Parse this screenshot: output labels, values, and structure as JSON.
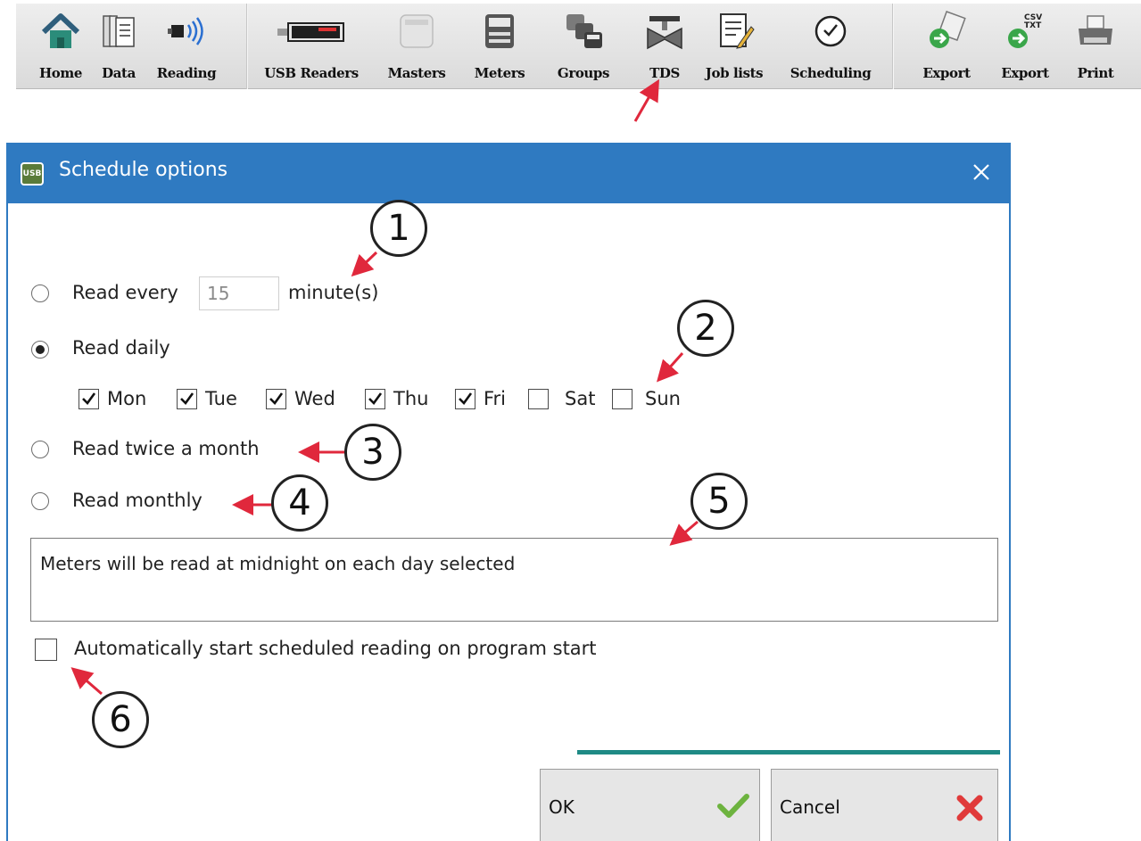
{
  "toolbar": {
    "items": [
      {
        "label": "Home",
        "icon": "home-icon"
      },
      {
        "label": "Data",
        "icon": "documents-icon"
      },
      {
        "label": "Reading",
        "icon": "signal-reader-icon"
      },
      {
        "label": "USB Readers",
        "icon": "usb-reader-icon"
      },
      {
        "label": "Masters",
        "icon": "master-meter-icon"
      },
      {
        "label": "Meters",
        "icon": "meter-icon"
      },
      {
        "label": "Groups",
        "icon": "meter-group-icon"
      },
      {
        "label": "TDS",
        "icon": "tds-valve-icon"
      },
      {
        "label": "Job lists",
        "icon": "job-list-icon"
      },
      {
        "label": "Scheduling",
        "icon": "clock-icon"
      },
      {
        "label": "Export",
        "icon": "export-icon"
      },
      {
        "label": "Export",
        "icon": "export-csv-txt-icon",
        "badge": "CSV\nTXT"
      },
      {
        "label": "Print",
        "icon": "printer-icon"
      }
    ]
  },
  "dialog": {
    "title": "Schedule options",
    "app_icon_text": "USB",
    "read_every": {
      "label": "Read every",
      "value": "15",
      "unit": "minute(s)",
      "checked": false
    },
    "read_daily": {
      "label": "Read daily",
      "checked": true
    },
    "days": [
      {
        "label": "Mon",
        "checked": true
      },
      {
        "label": "Tue",
        "checked": true
      },
      {
        "label": "Wed",
        "checked": true
      },
      {
        "label": "Thu",
        "checked": true
      },
      {
        "label": "Fri",
        "checked": true
      },
      {
        "label": "Sat",
        "checked": false
      },
      {
        "label": "Sun",
        "checked": false
      }
    ],
    "read_twice": {
      "label": "Read twice a month",
      "checked": false
    },
    "read_monthly": {
      "label": "Read monthly",
      "checked": false
    },
    "info_text": "Meters will be read at midnight on each day selected",
    "autostart": {
      "label": "Automatically start scheduled reading on program start",
      "checked": false
    },
    "ok_label": "OK",
    "cancel_label": "Cancel"
  },
  "callouts": [
    "1",
    "2",
    "3",
    "4",
    "5",
    "6"
  ],
  "colors": {
    "titlebar": "#2f7ac1",
    "accent_line": "#1f8a85",
    "arrow": "#e0283c",
    "ok_check": "#6db33f",
    "cancel_x": "#e03a3a"
  }
}
